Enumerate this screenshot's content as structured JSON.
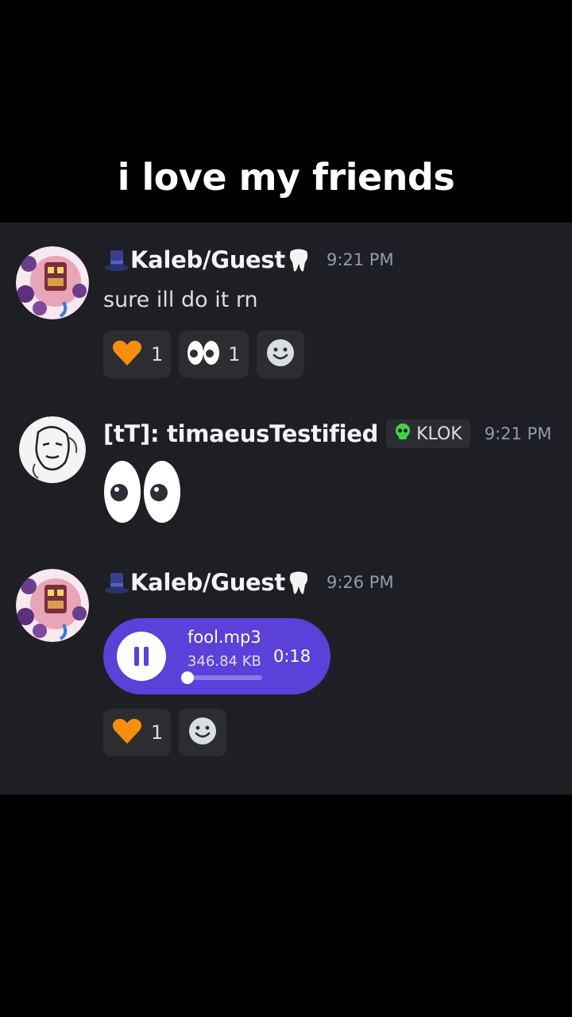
{
  "caption": "i love my friends",
  "colors": {
    "background": "#1e1f24",
    "reaction_bg": "#2b2d31",
    "audio_player": "#5b41d9",
    "timestamp": "#949ba4"
  },
  "messages": [
    {
      "username": "Kaleb/Guest",
      "name_prefix_icon": "top-hat-icon",
      "name_suffix_icon": "tooth-icon",
      "timestamp": "9:21 PM",
      "text": "sure ill do it rn",
      "reactions": [
        {
          "icon": "orange-heart-icon",
          "count": "1"
        },
        {
          "icon": "eyes-icon",
          "count": "1"
        },
        {
          "icon": "add-reaction-icon",
          "count": ""
        }
      ]
    },
    {
      "username": "[tT]: timaeusTestified",
      "tag_icon": "green-skull-icon",
      "tag": "KLOK",
      "timestamp": "9:21 PM",
      "content_icon": "eyes-emoji"
    },
    {
      "username": "Kaleb/Guest",
      "name_prefix_icon": "top-hat-icon",
      "name_suffix_icon": "tooth-icon",
      "timestamp": "9:26 PM",
      "attachment": {
        "file_name": "fool.mp3",
        "file_size": "346.84 KB",
        "duration": "0:18",
        "progress": 0.0,
        "state_icon": "pause-icon"
      },
      "reactions": [
        {
          "icon": "orange-heart-icon",
          "count": "1"
        },
        {
          "icon": "add-reaction-icon",
          "count": ""
        }
      ]
    }
  ]
}
